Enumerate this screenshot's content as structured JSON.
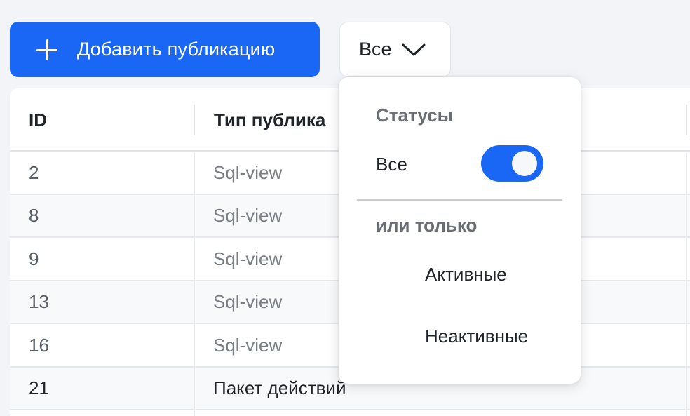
{
  "toolbar": {
    "add_label": "Добавить публикацию",
    "filter_label": "Все"
  },
  "table": {
    "columns": [
      "ID",
      "Тип публика"
    ],
    "rows": [
      {
        "id": "2",
        "type": "Sql-view"
      },
      {
        "id": "8",
        "type": "Sql-view"
      },
      {
        "id": "9",
        "type": "Sql-view"
      },
      {
        "id": "13",
        "type": "Sql-view"
      },
      {
        "id": "16",
        "type": "Sql-view"
      },
      {
        "id": "21",
        "type": "Пакет действий"
      }
    ]
  },
  "dropdown": {
    "statuses_heading": "Статусы",
    "all_label": "Все",
    "all_toggle_on": true,
    "or_only_heading": "или только",
    "options": [
      "Активные",
      "Неактивные"
    ]
  },
  "colors": {
    "accent": "#1a66f5",
    "background": "#f2f4f8"
  }
}
